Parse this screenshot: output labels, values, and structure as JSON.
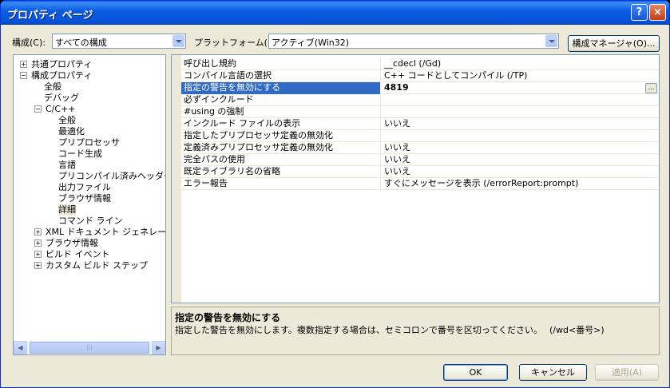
{
  "window": {
    "title": "プロパティ ページ",
    "help_label": "?",
    "close_label": "×"
  },
  "toolbar": {
    "config_label": "構成(C):",
    "config_value": "すべての構成",
    "platform_label": "プラットフォーム(P):",
    "platform_value": "アクティブ(Win32)",
    "manager_button": "構成マネージャ(O)..."
  },
  "tree": {
    "items": [
      {
        "label": "共通プロパティ",
        "exp": "+"
      },
      {
        "label": "構成プロパティ",
        "exp": "−"
      },
      {
        "label": "全般",
        "exp": ""
      },
      {
        "label": "デバッグ",
        "exp": ""
      },
      {
        "label": "C/C++",
        "exp": "−"
      },
      {
        "label": "全般",
        "exp": ""
      },
      {
        "label": "最適化",
        "exp": ""
      },
      {
        "label": "プリプロセッサ",
        "exp": ""
      },
      {
        "label": "コード生成",
        "exp": ""
      },
      {
        "label": "言語",
        "exp": ""
      },
      {
        "label": "プリコンパイル済みヘッダー",
        "exp": ""
      },
      {
        "label": "出力ファイル",
        "exp": ""
      },
      {
        "label": "ブラウザ情報",
        "exp": ""
      },
      {
        "label": "詳細",
        "exp": ""
      },
      {
        "label": "コマンド ライン",
        "exp": ""
      },
      {
        "label": "XML ドキュメント ジェネレータ",
        "exp": "+"
      },
      {
        "label": "ブラウザ情報",
        "exp": "+"
      },
      {
        "label": "ビルド イベント",
        "exp": "+"
      },
      {
        "label": "カスタム ビルド ステップ",
        "exp": "+"
      }
    ],
    "scroll_thumb": "|||"
  },
  "properties": [
    {
      "name": "呼び出し規約",
      "value": "__cdecl (/Gd)"
    },
    {
      "name": "コンパイル言語の選択",
      "value": "C++ コードとしてコンパイル (/TP)"
    },
    {
      "name": "指定の警告を無効にする",
      "value": "4819"
    },
    {
      "name": "必ずインクルード",
      "value": ""
    },
    {
      "name": "#using の強制",
      "value": ""
    },
    {
      "name": "インクルード ファイルの表示",
      "value": "いいえ"
    },
    {
      "name": "指定したプリプロセッサ定義の無効化",
      "value": ""
    },
    {
      "name": "定義済みプリプロセッサ定義の無効化",
      "value": "いいえ"
    },
    {
      "name": "完全パスの使用",
      "value": "いいえ"
    },
    {
      "name": "既定ライブラリ名の省略",
      "value": "いいえ"
    },
    {
      "name": "エラー報告",
      "value": "すぐにメッセージを表示 (/errorReport:prompt)"
    }
  ],
  "ellipsis_label": "...",
  "description": {
    "title": "指定の警告を無効にする",
    "text": "指定した警告を無効にします。複数指定する場合は、セミコロンで番号を区切ってください。　 (/wd<番号>)"
  },
  "buttons": {
    "ok": "OK",
    "cancel": "キャンセル",
    "apply": "適用(A)"
  }
}
